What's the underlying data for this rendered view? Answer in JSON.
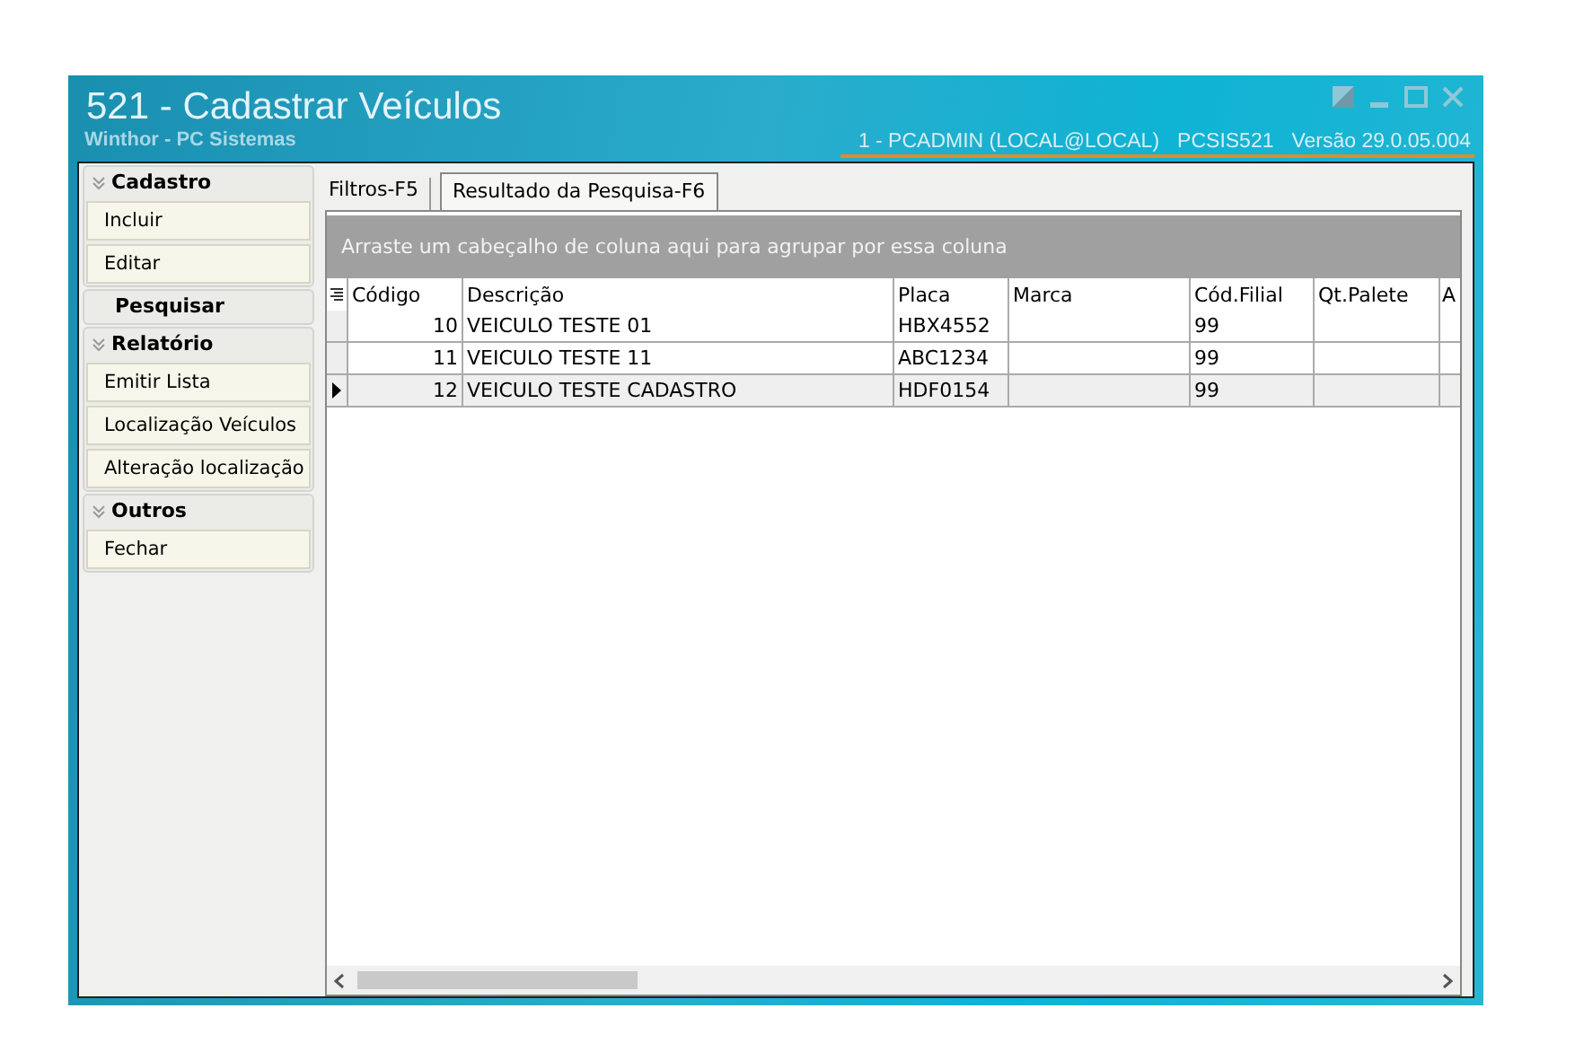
{
  "window": {
    "title": "521 - Cadastrar Veículos",
    "subtitle": "Winthor - PC Sistemas",
    "user": "1 - PCADMIN (LOCAL@LOCAL)",
    "program": "PCSIS521",
    "version": "Versão  29.0.05.004"
  },
  "sidebar": {
    "groups": [
      {
        "title": "Cadastro",
        "expanded": true,
        "items": [
          "Incluir",
          "Editar"
        ]
      },
      {
        "title": "Pesquisar",
        "expanded": false
      },
      {
        "title": "Relatório",
        "expanded": true,
        "items": [
          "Emitir Lista",
          "Localização Veículos",
          "Alteração localização"
        ]
      },
      {
        "title": "Outros",
        "expanded": true,
        "items": [
          "Fechar"
        ]
      }
    ]
  },
  "tabs": [
    {
      "label": "Filtros-F5",
      "selected": false
    },
    {
      "label": "Resultado da Pesquisa-F6",
      "selected": true
    }
  ],
  "group_panel": {
    "hint": "Arraste um cabeçalho de coluna aqui para agrupar por essa coluna"
  },
  "table": {
    "columns": [
      {
        "label": "Código",
        "kind": "number"
      },
      {
        "label": "Descrição",
        "kind": "text"
      },
      {
        "label": "Placa",
        "kind": "text"
      },
      {
        "label": "Marca",
        "kind": "text"
      },
      {
        "label": "Cód.Filial",
        "kind": "text"
      },
      {
        "label": "Qt.Palete",
        "kind": "text"
      },
      {
        "label": "A",
        "kind": "text"
      }
    ],
    "rows": [
      {
        "cells": [
          "10",
          "VEICULO TESTE 01",
          "HBX4552",
          "",
          "99",
          "",
          ""
        ],
        "selected": false
      },
      {
        "cells": [
          "11",
          "VEICULO TESTE 11",
          "ABC1234",
          "",
          "99",
          "",
          ""
        ],
        "selected": false
      },
      {
        "cells": [
          "12",
          "VEICULO TESTE CADASTRO",
          "HDF0154",
          "",
          "99",
          "",
          ""
        ],
        "selected": true
      }
    ]
  }
}
